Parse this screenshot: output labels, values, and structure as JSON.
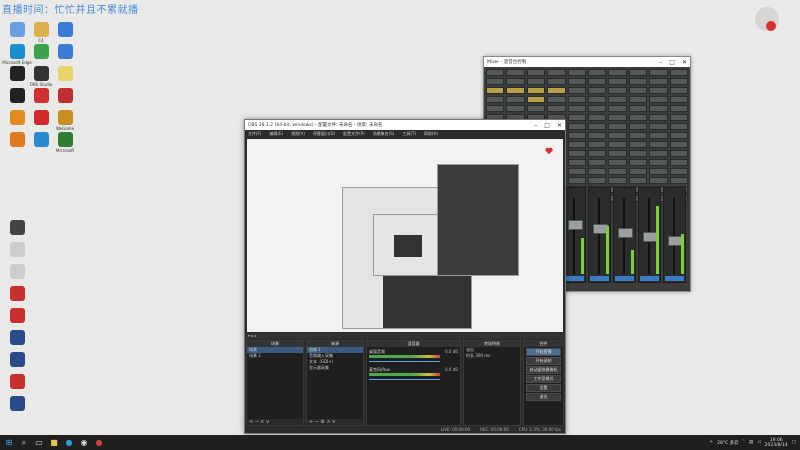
{
  "overlay": {
    "text": "直播时间：忙忙并且不累就播"
  },
  "colors": {
    "desktop": "#e9e9e7",
    "taskbar": "#1f1f1f",
    "accent": "#4a8ad8",
    "obs_bg": "#2b2b2b",
    "mixer_bg": "#3a3d3a"
  },
  "desktop_icons": [
    {
      "label": "",
      "icon": "dot-icon",
      "color": "#6aa0e0"
    },
    {
      "label": "C4",
      "icon": "folder-icon",
      "color": "#d9b04a"
    },
    {
      "label": "",
      "icon": "pc-icon",
      "color": "#3a7bd5"
    },
    {
      "label": "Microsoft Edge",
      "icon": "edge-icon",
      "color": "#1b8ecf"
    },
    {
      "label": "",
      "icon": "app-icon",
      "color": "#3da24a"
    },
    {
      "label": "",
      "icon": "monitor-icon",
      "color": "#3a7bd5"
    },
    {
      "label": "",
      "icon": "app-icon",
      "color": "#222222"
    },
    {
      "label": "OBS Studio",
      "icon": "obs-icon",
      "color": "#333333"
    },
    {
      "label": "",
      "icon": "file-icon",
      "color": "#e8d26a"
    },
    {
      "label": "",
      "icon": "qq-icon",
      "color": "#222222"
    },
    {
      "label": "",
      "icon": "app-icon",
      "color": "#d03030"
    },
    {
      "label": "",
      "icon": "app-icon",
      "color": "#c03030"
    },
    {
      "label": "",
      "icon": "app-icon",
      "color": "#e08a20"
    },
    {
      "label": "",
      "icon": "netease-icon",
      "color": "#d02a2a"
    },
    {
      "label": "WeGame",
      "icon": "wegame-icon",
      "color": "#c89020"
    },
    {
      "label": "",
      "icon": "app-icon",
      "color": "#e07a20"
    },
    {
      "label": "",
      "icon": "app-icon",
      "color": "#2a8ad0"
    },
    {
      "label": "Microsoft",
      "icon": "excel-icon",
      "color": "#2e7d32"
    },
    {
      "label": "",
      "icon": "app-icon",
      "color": "#444444"
    },
    {
      "label": "",
      "icon": "doc-icon",
      "color": "#cccccc"
    },
    {
      "label": "",
      "icon": "doc-icon",
      "color": "#cccccc"
    },
    {
      "label": "",
      "icon": "app-icon",
      "color": "#c83030"
    },
    {
      "label": "",
      "icon": "app-icon",
      "color": "#c83030"
    },
    {
      "label": "",
      "icon": "app-icon",
      "color": "#2a4a8a"
    },
    {
      "label": "",
      "icon": "app-icon",
      "color": "#2a4a8a"
    },
    {
      "label": "",
      "icon": "app-icon",
      "color": "#c83030"
    },
    {
      "label": "",
      "icon": "app-icon",
      "color": "#2a4a8a"
    }
  ],
  "mixer": {
    "title": "Mixer - 混音台控制"
  },
  "obs": {
    "title": "OBS 28.1.2 (64-bit, windows) - 配置文件: 未命名 - 场景: 未命名",
    "menu": [
      "文件(F)",
      "编辑(E)",
      "视图(V)",
      "停靠窗口(D)",
      "配置文件(P)",
      "场景集合(S)",
      "工具(T)",
      "帮助(H)"
    ],
    "docks": {
      "scenes_header": "场景",
      "scenes": [
        "场景",
        "场景 2"
      ],
      "sources_header": "来源",
      "sources": [
        "图像 1",
        "音频输入采集",
        "文本（GDI+）",
        "显示器采集"
      ],
      "mixer_header": "混音器",
      "channels": [
        {
          "name": "桌面音频",
          "value": "0.0 dB"
        },
        {
          "name": "麦克风/Aux",
          "value": "0.0 dB"
        }
      ],
      "transitions_header": "转场特效",
      "transition_type": "淡出",
      "duration_label": "时长",
      "duration_value": "300 ms",
      "controls_header": "控件",
      "controls": [
        "开始直播",
        "开始录制",
        "启动虚拟摄像机",
        "工作室模式",
        "设置",
        "退出"
      ]
    },
    "status": [
      "LIVE: 00:00:00",
      "REC: 00:00:00",
      "CPU: 1.3%, 30.00 fps"
    ]
  },
  "taskbar": {
    "weather": "28°C 多云",
    "time": "19:06",
    "date": "2023/8/14"
  }
}
